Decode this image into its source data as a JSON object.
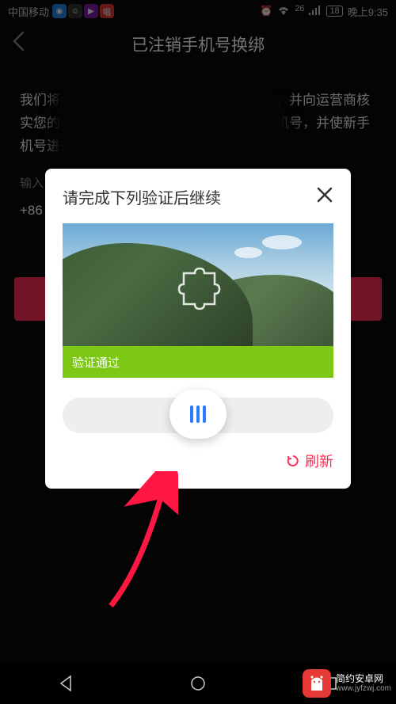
{
  "status_bar": {
    "carrier": "中国移动",
    "network": "26",
    "battery": "18",
    "time": "晚上9:35",
    "icons": [
      "alarm",
      "wifi",
      "signal"
    ]
  },
  "header": {
    "title": "已注销手机号换绑",
    "back": "back-chevron"
  },
  "body": {
    "description": "我们将会检查手机安全环境、验证帐号信息，并向运营商核实您的手机号状态，通过后可以绑定新的手机号，并使新手机号进行登录",
    "input_label": "输入",
    "phone_prefix": "+86"
  },
  "modal": {
    "title": "请完成下列验证后继续",
    "success_text": "验证通过",
    "refresh_label": "刷新"
  },
  "watermark": {
    "name": "简约安卓网",
    "url": "www.jyfzwj.com"
  }
}
